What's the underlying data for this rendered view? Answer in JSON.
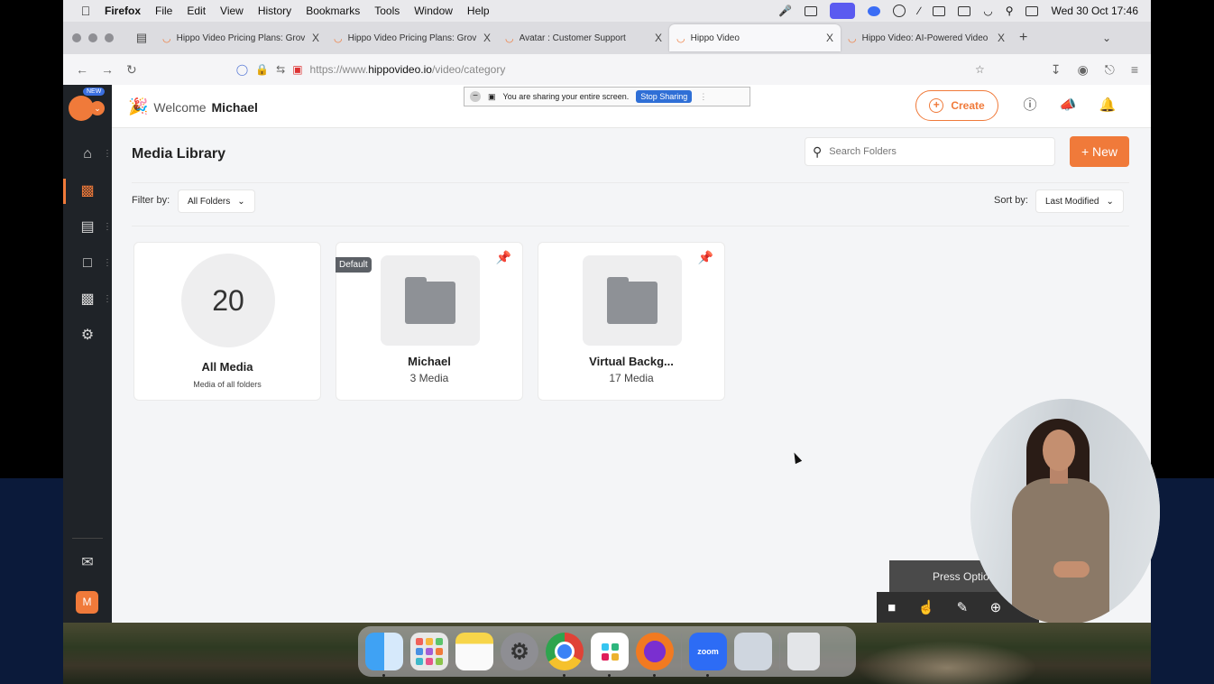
{
  "menubar": {
    "app": "Firefox",
    "items": [
      "File",
      "Edit",
      "View",
      "History",
      "Bookmarks",
      "Tools",
      "Window",
      "Help"
    ],
    "clock": "Wed 30 Oct  17:46"
  },
  "tabs": [
    {
      "title": "Hippo Video Pricing Plans: Grov",
      "close": "X"
    },
    {
      "title": "Hippo Video Pricing Plans: Grov",
      "close": "X"
    },
    {
      "title": "Avatar : Customer Support",
      "close": "X"
    },
    {
      "title": "Hippo Video",
      "close": "X"
    },
    {
      "title": "Hippo Video: AI-Powered Video",
      "close": "X"
    }
  ],
  "tab_new": "+",
  "url": {
    "prefix": "https://www.",
    "domain": "hippovideo.io",
    "path": "/video/category"
  },
  "topbar": {
    "new_badge": "NEW",
    "welcome": "Welcome",
    "name": "Michael",
    "create": "Create"
  },
  "share_bar": {
    "text": "You are sharing your entire screen.",
    "stop": "Stop Sharing"
  },
  "library": {
    "title": "Media Library",
    "search_placeholder": "Search Folders",
    "new_button": "+ New",
    "filter_label": "Filter by:",
    "filter_value": "All Folders",
    "sort_label": "Sort by:",
    "sort_value": "Last Modified"
  },
  "cards": [
    {
      "count": "20",
      "title": "All Media",
      "subtitle": "Media of all folders"
    },
    {
      "badge": "Default",
      "title": "Michael",
      "subtitle": "3 Media"
    },
    {
      "title": "Virtual Backg...",
      "subtitle": "17 Media"
    }
  ],
  "sidebar": {
    "avatar": "M"
  },
  "recorder": {
    "hint": "Press Option"
  },
  "dock": {
    "zoom": "zoom"
  },
  "colors": {
    "accent": "#f07a3a",
    "sidebar": "#1f2328",
    "share_blue": "#2f6fd6"
  }
}
